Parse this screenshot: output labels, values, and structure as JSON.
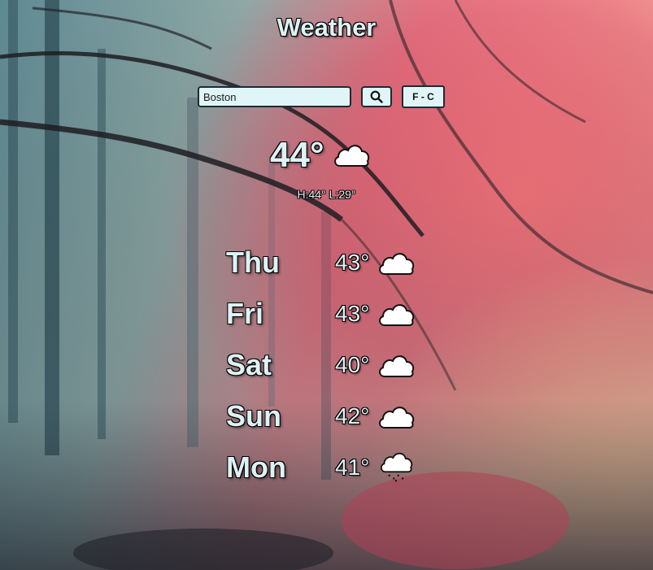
{
  "app": {
    "title": "Weather"
  },
  "search": {
    "value": "Boston",
    "button_icon": "search-icon"
  },
  "unit_toggle": {
    "label": "F - C"
  },
  "current": {
    "temp": "44°",
    "icon": "cloud-icon",
    "high": "H:44°",
    "low": "L:29°"
  },
  "forecast": [
    {
      "day": "Thu",
      "temp": "43°",
      "icon": "cloud-icon"
    },
    {
      "day": "Fri",
      "temp": "43°",
      "icon": "cloud-icon"
    },
    {
      "day": "Sat",
      "temp": "40°",
      "icon": "cloud-icon"
    },
    {
      "day": "Sun",
      "temp": "42°",
      "icon": "cloud-icon"
    },
    {
      "day": "Mon",
      "temp": "41°",
      "icon": "snow-cloud-icon"
    }
  ],
  "colors": {
    "text": "#dcf2f4",
    "outline": "#000000",
    "input_bg": "#dff5f7"
  },
  "background": "misty autumn forest photo"
}
